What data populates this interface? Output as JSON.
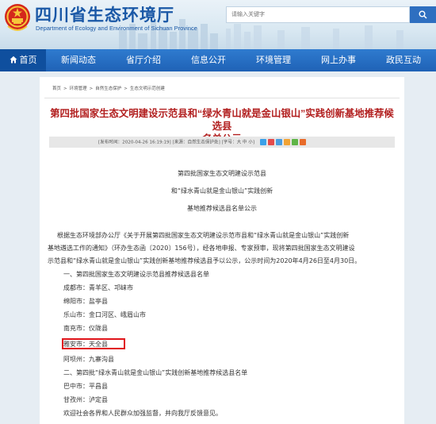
{
  "header": {
    "title": "四川省生态环境厅",
    "subtitle": "Department of Ecology and Environment of Sichuan Province",
    "search_placeholder": "请输入关键字",
    "search_icon": "search-icon",
    "emblem_icon": "national-emblem-icon"
  },
  "nav": {
    "items": [
      {
        "label": "首页",
        "icon": "home-icon",
        "active": true
      },
      {
        "label": "新闻动态"
      },
      {
        "label": "省厅介绍"
      },
      {
        "label": "信息公开"
      },
      {
        "label": "环境管理"
      },
      {
        "label": "网上办事"
      },
      {
        "label": "政民互动"
      }
    ]
  },
  "breadcrumb": [
    "首页",
    "环境管理",
    "自然生态保护",
    "生态文明示范创建"
  ],
  "article": {
    "title_line1": "第四批国家生态文明建设示范县和“绿水青山就是金山银山”实践创新基地推荐候选县",
    "title_line2": "名单公示",
    "meta": "[发布时间：2020-04-26 16:19:19] [来源：自然生态保护处] [字号：大 中 小]",
    "heading_lines": [
      "第四批国家生态文明建设示范县",
      "和“绿水青山就是金山银山”实践创新",
      "基地推荐候选县名单公示"
    ],
    "intro_lines": [
      "根据生态环境部办公厅《关于开展第四批国家生态文明建设示范市县和“绿水青山就是金山银山”实践创新",
      "基地遴选工作的通知》（环办生态函〔2020〕156号），经各地申报、专家预审，现将第四批国家生态文明建设",
      "示范县和“绿水青山就是金山银山”实践创新基地推荐候选县予以公示，公示时间为2020年4月26日至4月30日。"
    ],
    "section1_title": "一、第四批国家生态文明建设示范县推荐候选县名单",
    "section1_items": [
      "成都市：青羊区、邛崃市",
      "绵阳市：盐亭县",
      "乐山市：金口河区、峨眉山市",
      "南充市：仪陇县",
      "雅安市：天全县",
      "阿坝州：九寨沟县"
    ],
    "section2_title": "二、第四批“绿水青山就是金山银山”实践创新基地推荐候选县名单",
    "section2_items": [
      "巴中市：平昌县",
      "甘孜州：泸定县"
    ],
    "closing": "欢迎社会各界和人民群众加强监督，并向我厅反馈意见。"
  },
  "colors": {
    "brand_blue": "#1a58a6",
    "nav_blue": "#1f62b6",
    "nav_active": "#0f4f9e",
    "title_red": "#b21f1f",
    "highlight_red": "#e0141a"
  }
}
